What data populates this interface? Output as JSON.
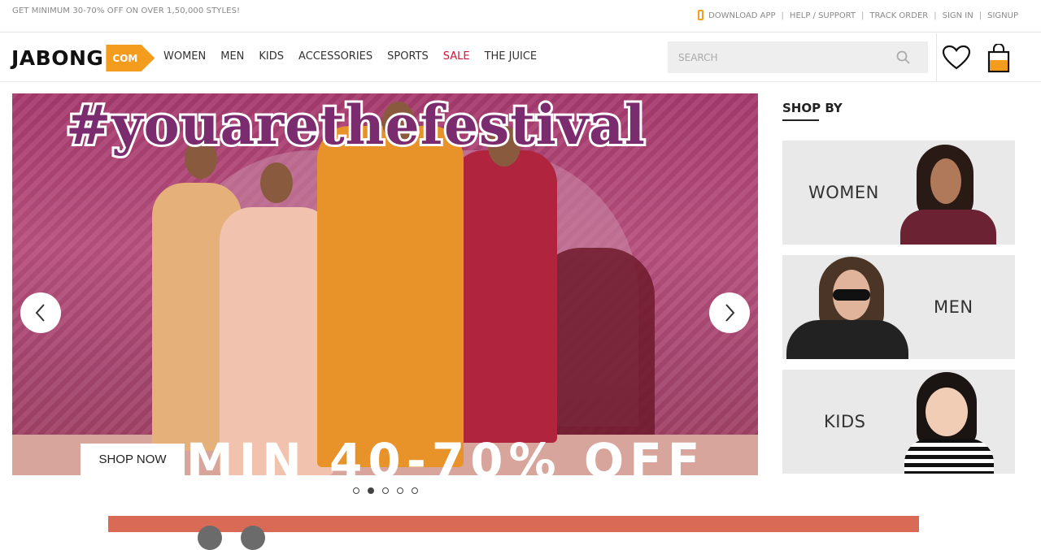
{
  "topbar": {
    "promo": "GET MINIMUM 30-70% OFF ON OVER 1,50,000 STYLES!",
    "links": [
      "DOWNLOAD APP",
      "HELP / SUPPORT",
      "TRACK ORDER",
      "SIGN IN",
      "SIGNUP"
    ],
    "separator": "|"
  },
  "header": {
    "logo_text": "JABONG",
    "logo_suffix": "COM",
    "nav": [
      "WOMEN",
      "MEN",
      "KIDS",
      "ACCESSORIES",
      "SPORTS",
      "SALE",
      "THE JUICE"
    ],
    "search_placeholder": "SEARCH"
  },
  "hero": {
    "tagline": "#youarethefestival",
    "offer": "MIN 40-70% OFF",
    "cta": "SHOP NOW",
    "slides": 5,
    "active_slide": 2
  },
  "shop_by": {
    "title": "SHOP BY",
    "cards": [
      "WOMEN",
      "MEN",
      "KIDS"
    ]
  },
  "colors": {
    "brand_orange": "#f39c1e",
    "sale_red": "#d0163c",
    "banner": "#d96a55"
  }
}
